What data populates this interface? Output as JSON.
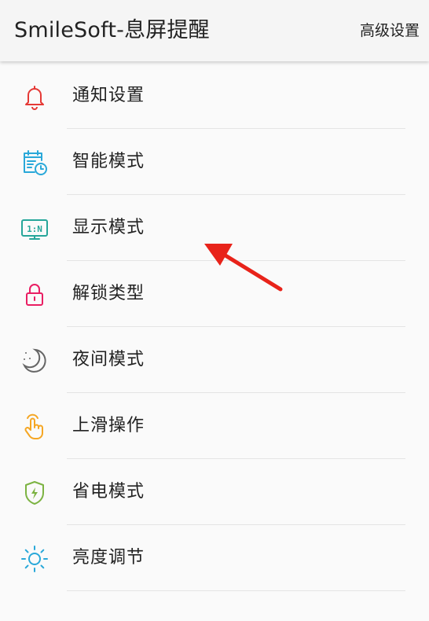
{
  "appbar": {
    "title": "SmileSoft-息屏提醒",
    "advanced_label": "高级设置"
  },
  "menu": {
    "items": [
      {
        "label": "通知设置",
        "icon": "bell-icon",
        "color": "#e53935"
      },
      {
        "label": "智能模式",
        "icon": "calendar-clock-icon",
        "color": "#29a8d9"
      },
      {
        "label": "显示模式",
        "icon": "display-mode-icon",
        "color": "#26a69a"
      },
      {
        "label": "解锁类型",
        "icon": "lock-icon",
        "color": "#e91e63"
      },
      {
        "label": "夜间模式",
        "icon": "moon-icon",
        "color": "#666666"
      },
      {
        "label": "上滑操作",
        "icon": "swipe-hand-icon",
        "color": "#f5a623"
      },
      {
        "label": "省电模式",
        "icon": "battery-shield-icon",
        "color": "#7cb342"
      },
      {
        "label": "亮度调节",
        "icon": "sun-icon",
        "color": "#29a8d9"
      }
    ]
  },
  "annotation": {
    "arrow_color": "#e8231a"
  }
}
